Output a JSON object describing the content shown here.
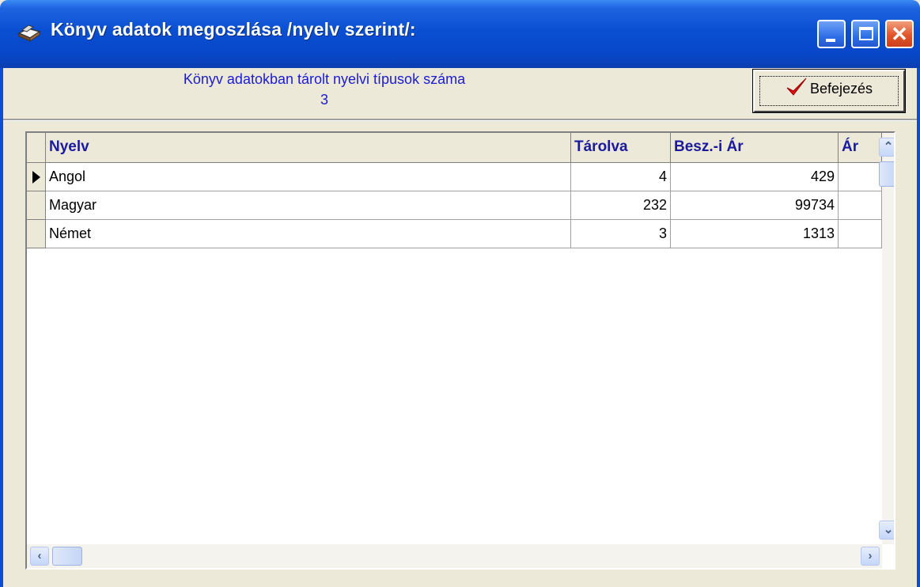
{
  "window": {
    "title": "Könyv adatok megoszlása /nyelv szerint/:",
    "close_glyph": "✕"
  },
  "summary": {
    "label": "Könyv adatokban tárolt nyelvi típusok száma",
    "count": "3"
  },
  "toolbar": {
    "finish_label": "Befejezés"
  },
  "table": {
    "columns": [
      "Nyelv",
      "Tárolva",
      "Besz.-i Ár",
      "Ár"
    ],
    "rows": [
      {
        "nyelv": "Angol",
        "tarolva": "4",
        "besz_ar": "429"
      },
      {
        "nyelv": "Magyar",
        "tarolva": "232",
        "besz_ar": "99734"
      },
      {
        "nyelv": "Német",
        "tarolva": "3",
        "besz_ar": "1313"
      }
    ],
    "selected_row": 0
  },
  "scroll": {
    "up": "⌃",
    "down": "⌄",
    "left": "‹",
    "right": "›"
  },
  "colors": {
    "accent": "#0a4fd2",
    "label_text": "#1c1cd2",
    "header_text": "#1a1a9f"
  }
}
